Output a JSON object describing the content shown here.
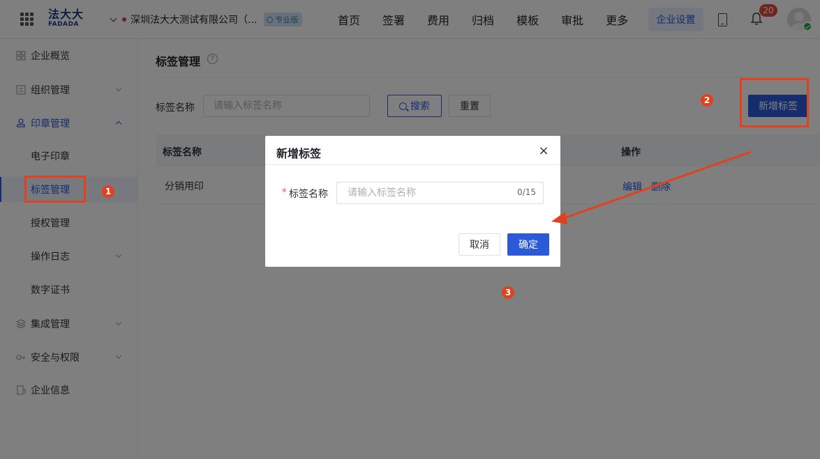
{
  "header": {
    "logo_cn": "法大大",
    "logo_en": "FADADA",
    "company_name": "深圳法大大测试有限公司（...",
    "edition_badge": "专业版",
    "nav": [
      "首页",
      "签署",
      "费用",
      "归档",
      "模板",
      "审批",
      "更多"
    ],
    "settings_tab": "企业设置",
    "notification_count": "20"
  },
  "sidebar": {
    "items": [
      {
        "label": "企业概览"
      },
      {
        "label": "组织管理"
      },
      {
        "label": "印章管理"
      },
      {
        "label": "电子印章"
      },
      {
        "label": "标签管理"
      },
      {
        "label": "授权管理"
      },
      {
        "label": "操作日志"
      },
      {
        "label": "数字证书"
      },
      {
        "label": "集成管理"
      },
      {
        "label": "安全与权限"
      },
      {
        "label": "企业信息"
      }
    ]
  },
  "main": {
    "page_title": "标签管理",
    "help": "?",
    "filter": {
      "label": "标签名称",
      "placeholder": "请输入标签名称",
      "search_button": "搜索",
      "reset_button": "重置"
    },
    "add_button": "新增标签",
    "table": {
      "columns": [
        "标签名称",
        "操作"
      ],
      "rows": [
        {
          "name": "分销用印",
          "actions": [
            "编辑",
            "删除"
          ]
        }
      ]
    }
  },
  "modal": {
    "title": "新增标签",
    "close": "×",
    "field_label": "标签名称",
    "required_mark": "*",
    "field_placeholder": "请输入标签名称",
    "char_count": "0/15",
    "cancel": "取消",
    "confirm": "确定"
  },
  "annotations": {
    "steps": [
      "1",
      "2",
      "3"
    ],
    "color": "#e1411f"
  },
  "colors": {
    "primary": "#2a5ad8",
    "badge_red": "#e14a3c",
    "annotation": "#e1411f"
  }
}
